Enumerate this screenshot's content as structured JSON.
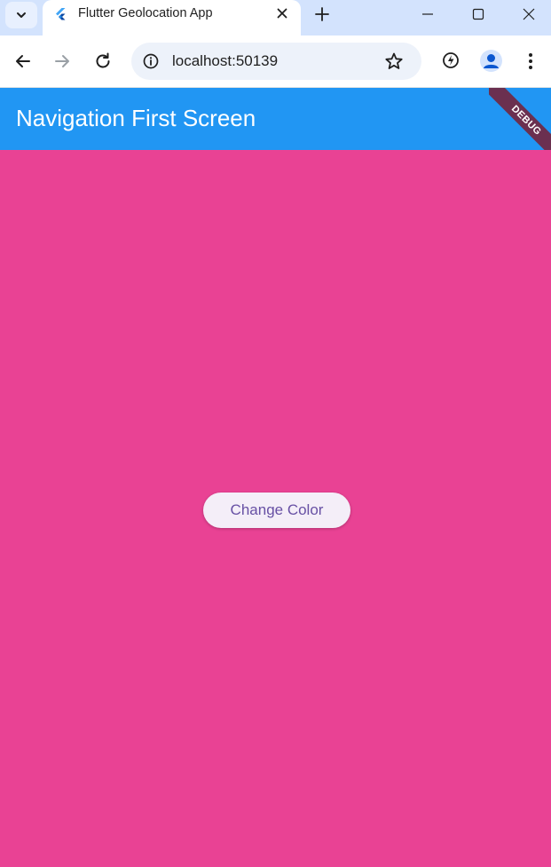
{
  "browser": {
    "tab": {
      "title": "Flutter Geolocation App"
    },
    "address": {
      "url": "localhost:50139"
    }
  },
  "app": {
    "appbar_title": "Navigation First Screen",
    "debug_label": "DEBUG",
    "button_label": "Change Color",
    "colors": {
      "appbar": "#2196f3",
      "background": "#e94294",
      "button_bg": "#f4eef8",
      "button_text": "#6750a4"
    }
  },
  "icons": [
    "tab-search-icon",
    "flutter-icon",
    "close-icon",
    "plus-icon",
    "minimize-icon",
    "maximize-icon",
    "window-close-icon",
    "back-icon",
    "forward-icon",
    "reload-icon",
    "site-info-icon",
    "star-icon",
    "performance-icon",
    "profile-icon",
    "more-vert-icon"
  ]
}
